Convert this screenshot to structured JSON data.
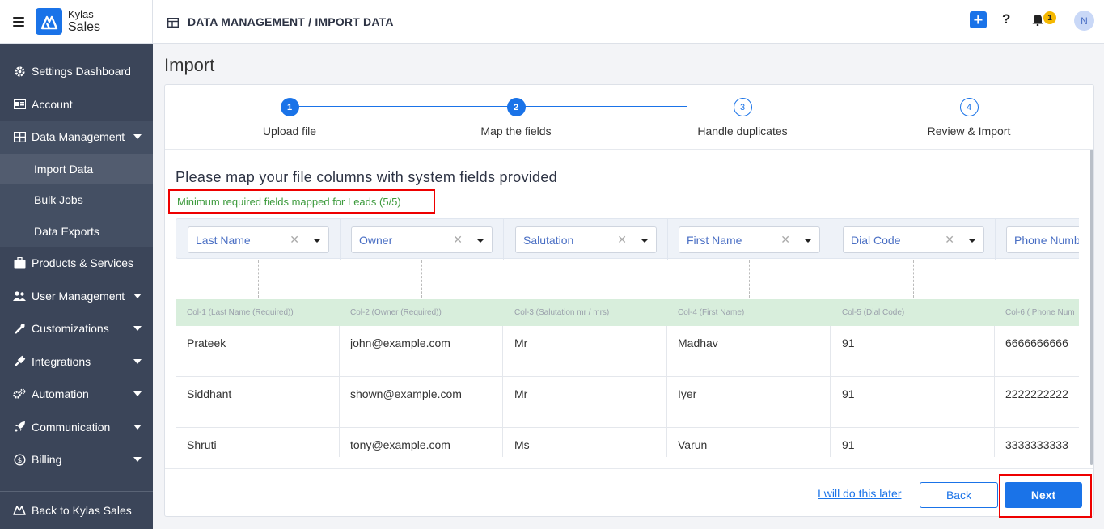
{
  "brand": {
    "line1": "Kylas",
    "line2": "Sales"
  },
  "topbar": {
    "breadcrumb": "DATA MANAGEMENT / IMPORT DATA",
    "notif_count": "1",
    "avatar_initial": "N"
  },
  "sidebar": {
    "items": [
      {
        "label": "Settings Dashboard",
        "icon": "gear-icon"
      },
      {
        "label": "Account",
        "icon": "id-card-icon"
      },
      {
        "label": "Data Management",
        "icon": "table-icon"
      },
      {
        "label": "Products & Services",
        "icon": "briefcase-icon"
      },
      {
        "label": "User Management",
        "icon": "users-icon"
      },
      {
        "label": "Customizations",
        "icon": "tools-icon"
      },
      {
        "label": "Integrations",
        "icon": "plug-icon"
      },
      {
        "label": "Automation",
        "icon": "cogs-icon"
      },
      {
        "label": "Communication",
        "icon": "rocket-icon"
      },
      {
        "label": "Billing",
        "icon": "dollar-icon"
      }
    ],
    "subitems": [
      "Import Data",
      "Bulk Jobs",
      "Data Exports"
    ],
    "footer": "Back to Kylas Sales"
  },
  "page": {
    "title": "Import"
  },
  "steps": [
    {
      "num": "1",
      "label": "Upload file"
    },
    {
      "num": "2",
      "label": "Map the fields"
    },
    {
      "num": "3",
      "label": "Handle duplicates"
    },
    {
      "num": "4",
      "label": "Review & Import"
    }
  ],
  "mapping": {
    "heading": "Please map your file columns with system fields provided",
    "required_msg": "Minimum required fields mapped for Leads (5/5)",
    "fields": [
      "Last Name",
      "Owner",
      "Salutation",
      "First Name",
      "Dial Code",
      "Phone Numb"
    ],
    "columns": [
      "Col-1 (Last Name (Required))",
      "Col-2 (Owner (Required))",
      "Col-3 (Salutation mr / mrs)",
      "Col-4 (First Name)",
      "Col-5 (Dial Code)",
      "Col-6 ( Phone Num"
    ],
    "rows": [
      [
        "Prateek",
        "john@example.com",
        "Mr",
        "Madhav",
        "91",
        "6666666666"
      ],
      [
        "Siddhant",
        "shown@example.com",
        "Mr",
        "Iyer",
        "91",
        "2222222222"
      ],
      [
        "Shruti",
        "tony@example.com",
        "Ms",
        "Varun",
        "91",
        "3333333333"
      ]
    ]
  },
  "footer": {
    "later": "I will do this later",
    "back": "Back",
    "next": "Next"
  },
  "colors": {
    "primary": "#1a73e8",
    "sidebar": "#3b4559",
    "success": "#3c9a3c",
    "highlight": "#e00000"
  }
}
